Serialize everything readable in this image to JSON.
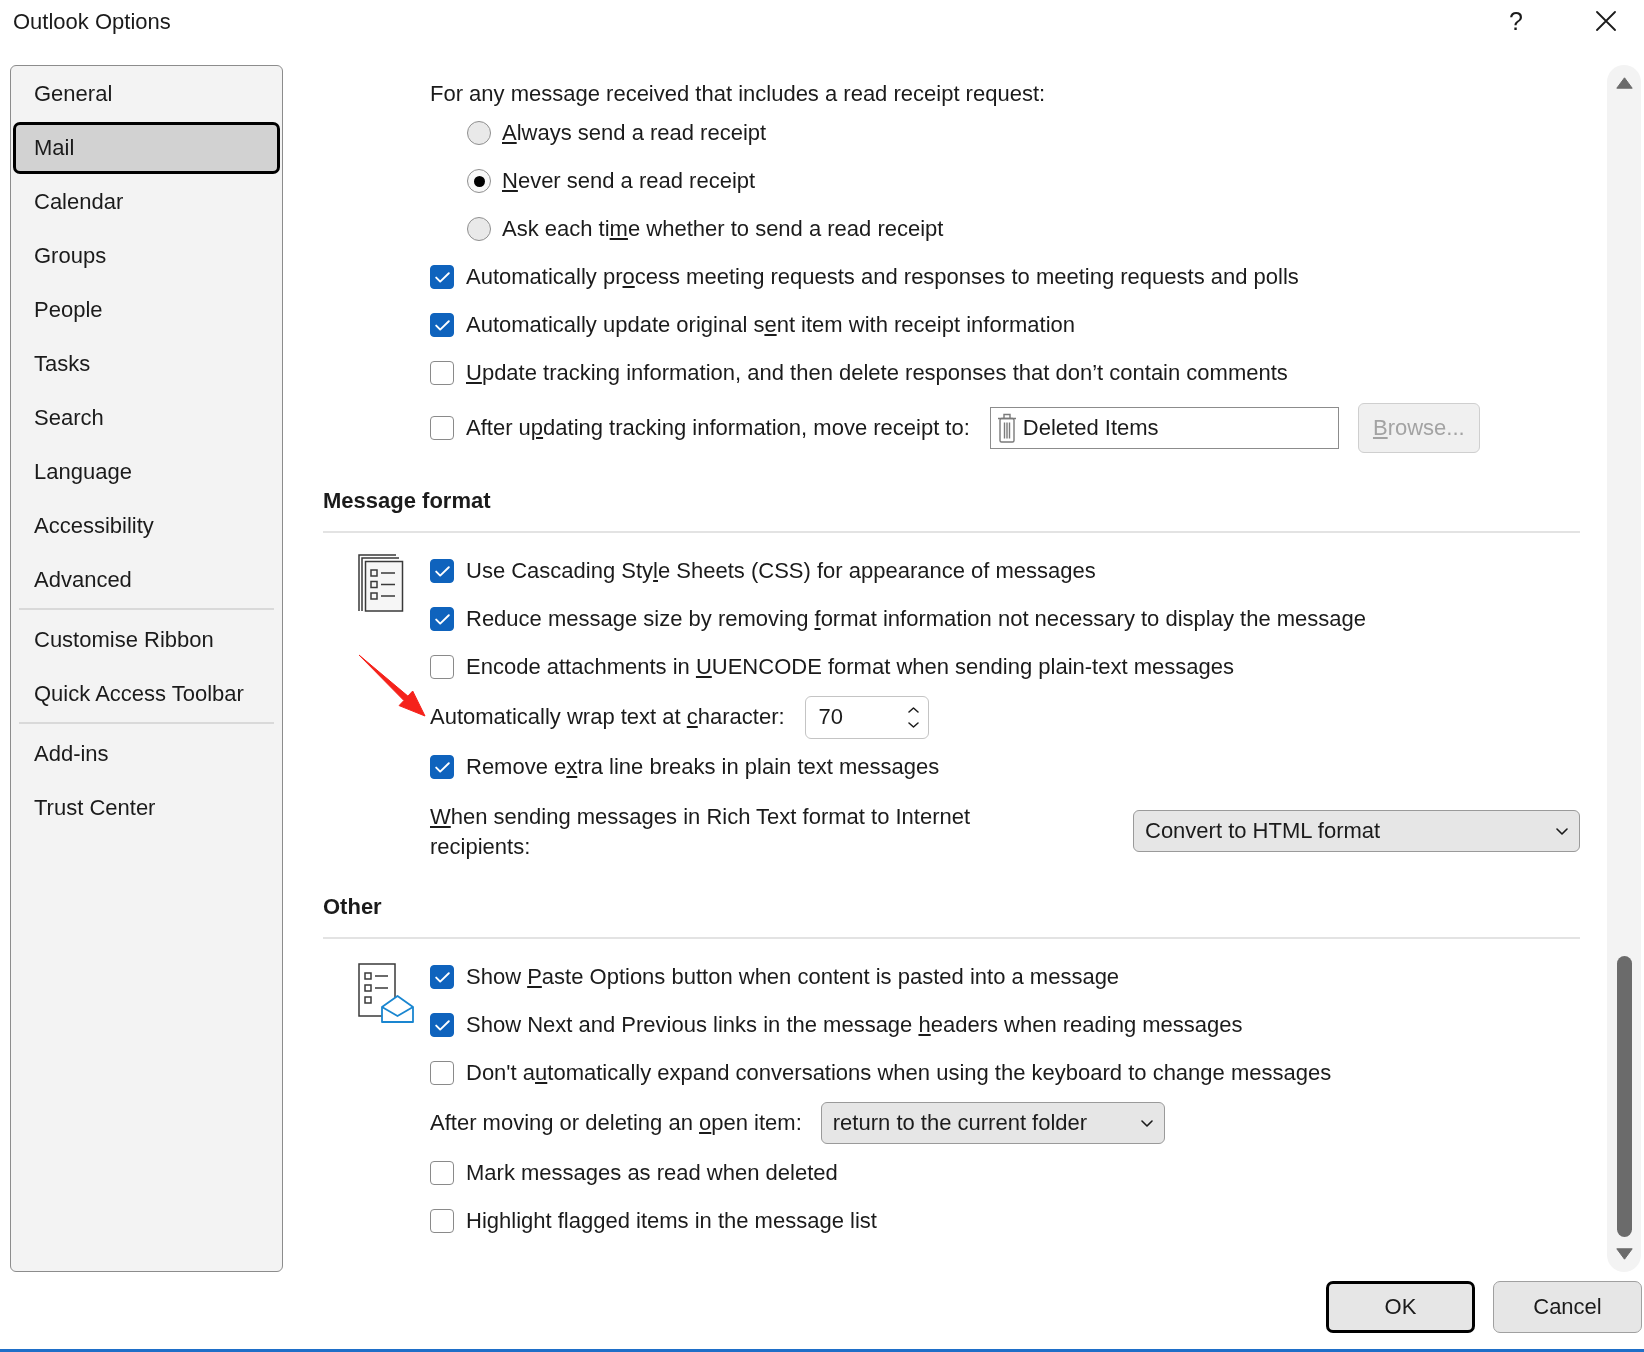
{
  "window": {
    "title": "Outlook Options",
    "help": "?"
  },
  "sidebar": {
    "groups": [
      [
        {
          "label": "General",
          "selected": false
        },
        {
          "label": "Mail",
          "selected": true
        },
        {
          "label": "Calendar",
          "selected": false
        },
        {
          "label": "Groups",
          "selected": false
        },
        {
          "label": "People",
          "selected": false
        },
        {
          "label": "Tasks",
          "selected": false
        },
        {
          "label": "Search",
          "selected": false
        },
        {
          "label": "Language",
          "selected": false
        },
        {
          "label": "Accessibility",
          "selected": false
        },
        {
          "label": "Advanced",
          "selected": false
        }
      ],
      [
        {
          "label": "Customise Ribbon",
          "selected": false
        },
        {
          "label": "Quick Access Toolbar",
          "selected": false
        }
      ],
      [
        {
          "label": "Add-ins",
          "selected": false
        },
        {
          "label": "Trust Center",
          "selected": false
        }
      ]
    ]
  },
  "receipts": {
    "prompt": "For any message received that includes a read receipt request:",
    "choices": [
      {
        "label": {
          "key": "A",
          "after": "lways send a read receipt"
        },
        "selected": false
      },
      {
        "label": {
          "key": "N",
          "after": "ever send a read receipt"
        },
        "selected": true
      },
      {
        "label": {
          "before": "Ask each ti",
          "key": "m",
          "after": "e whether to send a read receipt"
        },
        "selected": false
      }
    ]
  },
  "tracking": [
    {
      "kind": "checkbox",
      "checked": true,
      "label": {
        "before": "Automatically pr",
        "key": "o",
        "after": "cess meeting requests and responses to meeting requests and polls"
      }
    },
    {
      "kind": "checkbox",
      "checked": true,
      "label": {
        "before": "Automatically update original s",
        "key": "e",
        "after": "nt item with receipt information"
      }
    },
    {
      "kind": "checkbox",
      "checked": false,
      "label": {
        "key": "U",
        "after": "pdate tracking information, and then delete responses that don’t contain comments"
      }
    },
    {
      "kind": "folder",
      "checked": false,
      "label": {
        "before": "After u",
        "key": "p",
        "after": "dating tracking information, move receipt to:"
      },
      "folder": "Deleted Items",
      "browse": {
        "label": {
          "key": "B",
          "after": "rowse..."
        },
        "disabled": true
      }
    }
  ],
  "sections": [
    {
      "kind": "format",
      "title": "Message format",
      "options": [
        {
          "kind": "checkbox",
          "checked": true,
          "label": {
            "before": "Use Cascading Sty",
            "key": "l",
            "after": "e Sheets (CSS) for appearance of messages"
          }
        },
        {
          "kind": "checkbox",
          "checked": true,
          "label": {
            "before": "Reduce message size by removing ",
            "key": "f",
            "after": "ormat information not necessary to display the message"
          }
        },
        {
          "kind": "checkbox",
          "checked": false,
          "label": {
            "before": "Encode attachments in ",
            "key": "U",
            "after": "UENCODE format when sending plain-text messages"
          }
        },
        {
          "kind": "spinner",
          "label": {
            "before": "Automatically wrap text at ",
            "key": "c",
            "after": "haracter:"
          },
          "value": "70",
          "arrow": true
        },
        {
          "kind": "checkbox",
          "checked": true,
          "label": {
            "before": "Remove e",
            "key": "x",
            "after": "tra line breaks in plain text messages"
          }
        },
        {
          "kind": "dropdown",
          "label": {
            "key": "W",
            "after": "hen sending messages in Rich Text format to Internet recipients:"
          },
          "value": "Convert to HTML format"
        }
      ]
    },
    {
      "kind": "other",
      "title": "Other",
      "options": [
        {
          "kind": "checkbox",
          "checked": true,
          "label": {
            "before": "Show ",
            "key": "P",
            "after": "aste Options button when content is pasted into a message"
          }
        },
        {
          "kind": "checkbox",
          "checked": true,
          "label": {
            "before": "Show Next and Previous links in the message ",
            "key": "h",
            "after": "eaders when reading messages"
          }
        },
        {
          "kind": "checkbox",
          "checked": false,
          "label": {
            "before": "Don't a",
            "key": "u",
            "after": "tomatically expand conversations when using the keyboard to change messages"
          }
        },
        {
          "kind": "combo",
          "label": {
            "before": "After moving or deleting an ",
            "key": "o",
            "after": "pen item:"
          },
          "value": "return to the current folder"
        },
        {
          "kind": "checkbox",
          "checked": false,
          "label": "Mark messages as read when deleted"
        },
        {
          "kind": "checkbox",
          "checked": false,
          "label": "Highlight flagged items in the message list"
        }
      ]
    }
  ],
  "buttons": [
    {
      "label": "OK",
      "default": true
    },
    {
      "label": "Cancel",
      "default": false
    }
  ]
}
